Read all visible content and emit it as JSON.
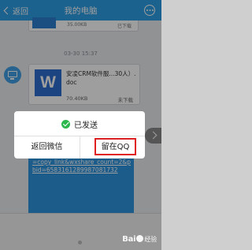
{
  "header": {
    "back_label": "返回",
    "title": "我的电脑"
  },
  "chat": {
    "top_card": {
      "size": "35.00KB",
      "status": "已下载"
    },
    "timestamp": "03-30 15:37",
    "file_card": {
      "icon_letter": "W",
      "name": "安凌CRM软件服...30人）.doc",
      "size": "70.40KB",
      "status": "未下载"
    },
    "link_text": "0928&share_ht_uid=102343227944&did=38259551542&utm_medium=toutiao_android&tt_from=copy_link&wxshare_count=2&pbid=6583161289987081732"
  },
  "dialog": {
    "message": "已发送",
    "left_button": "返回微信",
    "right_button": "留在QQ",
    "highlight_color": "#e02020",
    "check_color": "#2db84d"
  },
  "watermark": {
    "brand": "Bai",
    "brand_tail": "经验"
  },
  "colors": {
    "header": "#2e9ee6",
    "bubble": "#2e95e0",
    "word_icon": "#2c6fd0"
  }
}
